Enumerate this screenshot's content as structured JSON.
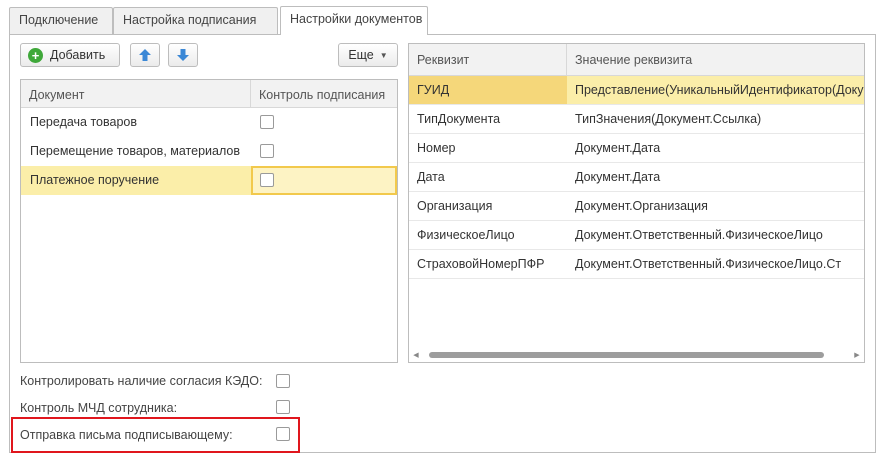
{
  "tabs": [
    {
      "label": "Подключение"
    },
    {
      "label": "Настройка подписания"
    },
    {
      "label": "Настройки документов"
    }
  ],
  "toolbar": {
    "add_label": "Добавить",
    "more_label": "Еще"
  },
  "documents_table": {
    "columns": [
      "Документ",
      "Контроль подписания"
    ],
    "rows": [
      {
        "document": "Передача товаров",
        "control": false
      },
      {
        "document": "Перемещение товаров, материалов",
        "control": false
      },
      {
        "document": "Платежное поручение",
        "control": false,
        "selected": true
      }
    ]
  },
  "requisites_table": {
    "columns": [
      "Реквизит",
      "Значение реквизита"
    ],
    "rows": [
      {
        "name": "ГУИД",
        "value": "Представление(УникальныйИдентификатор(Документ.Ссылка))",
        "selected": true
      },
      {
        "name": "ТипДокумента",
        "value": "ТипЗначения(Документ.Ссылка)"
      },
      {
        "name": "Номер",
        "value": "Документ.Дата"
      },
      {
        "name": "Дата",
        "value": "Документ.Дата"
      },
      {
        "name": "Организация",
        "value": "Документ.Организация"
      },
      {
        "name": "ФизическоеЛицо",
        "value": "Документ.Ответственный.ФизическоеЛицо"
      },
      {
        "name": "СтраховойНомерПФР",
        "value": "Документ.Ответственный.ФизическоеЛицо.Ст"
      }
    ]
  },
  "options": [
    {
      "label": "Контролировать наличие согласия КЭДО:",
      "checked": false
    },
    {
      "label": "Контроль МЧД сотрудника:",
      "checked": false
    },
    {
      "label": "Отправка письма подписывающему:",
      "checked": false
    }
  ],
  "colors": {
    "selection": "#fbeea9",
    "highlight_border": "#e0161d",
    "add_icon": "#3fa83a",
    "arrow_icon": "#3b88d6"
  }
}
